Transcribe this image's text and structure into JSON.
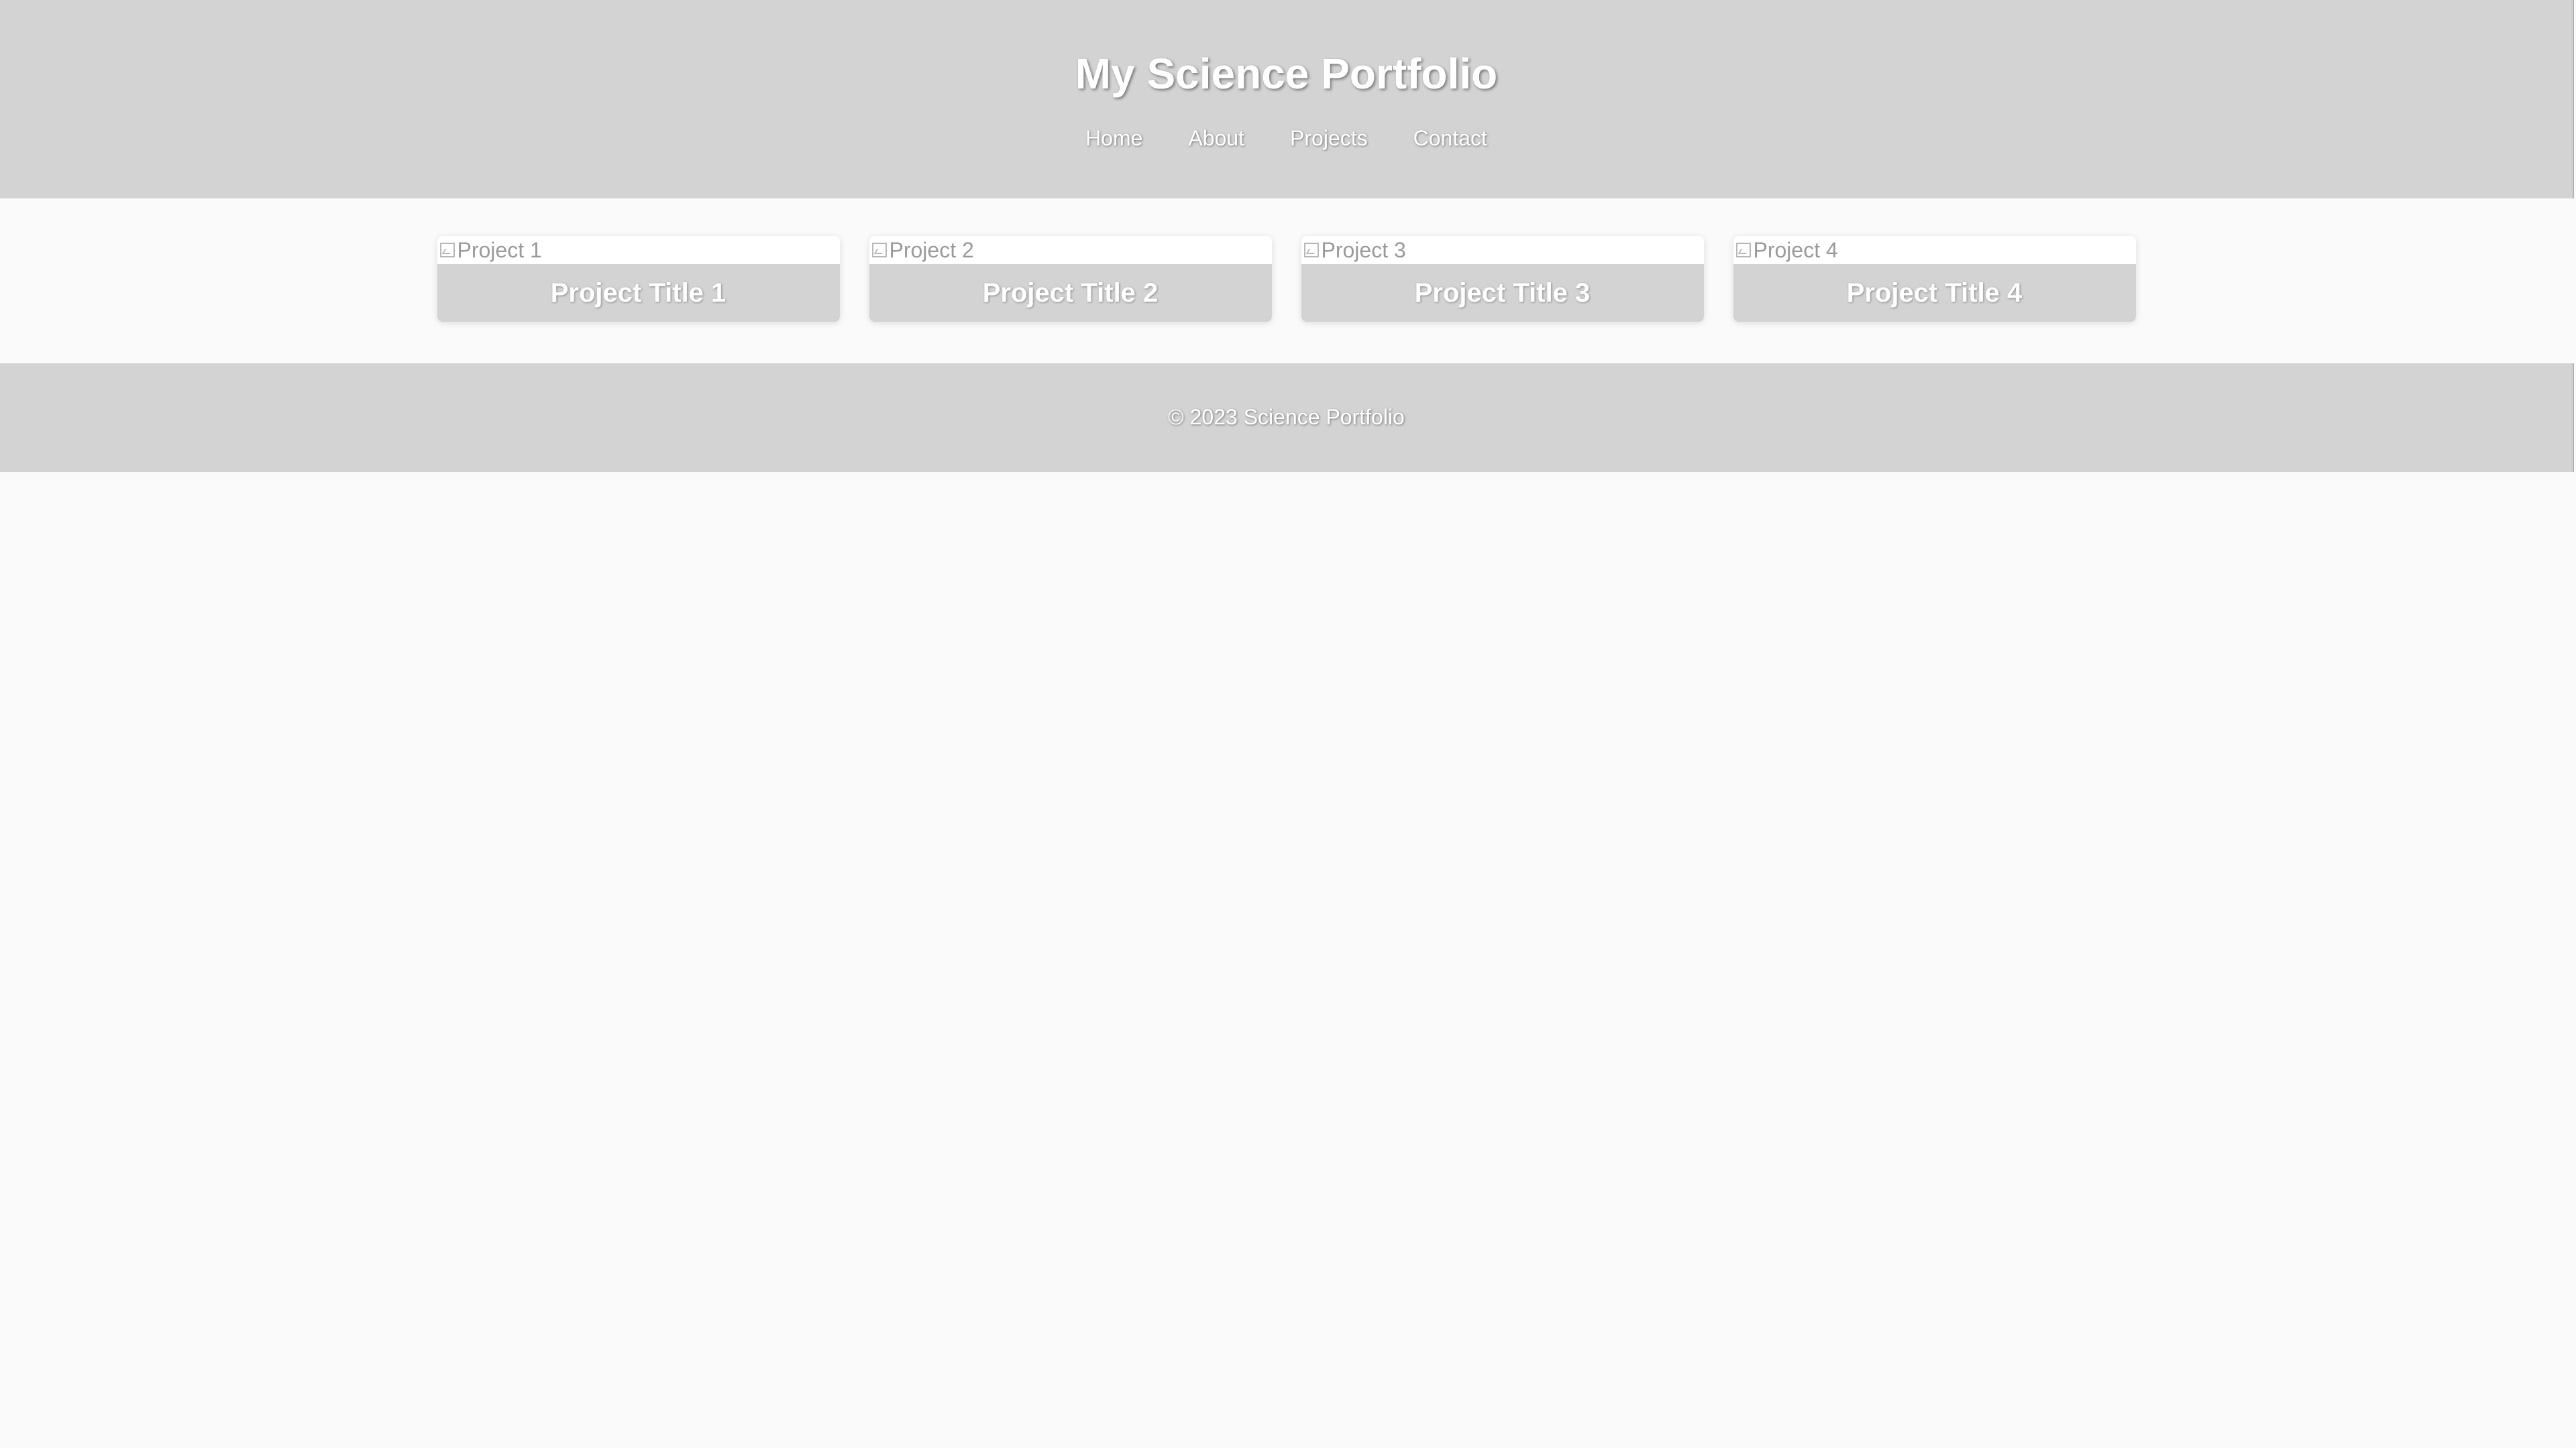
{
  "header": {
    "title": "My Science Portfolio",
    "nav": [
      "Home",
      "About",
      "Projects",
      "Contact"
    ]
  },
  "projects": [
    {
      "image_alt": "Project 1",
      "title": "Project Title 1"
    },
    {
      "image_alt": "Project 2",
      "title": "Project Title 2"
    },
    {
      "image_alt": "Project 3",
      "title": "Project Title 3"
    },
    {
      "image_alt": "Project 4",
      "title": "Project Title 4"
    }
  ],
  "footer": {
    "text": "© 2023 Science Portfolio"
  },
  "colors": {
    "header_bg": "#d3d3d3",
    "page_bg": "#fafafa",
    "text_light": "#ffffff",
    "alt_text": "#9a9a9a"
  },
  "icons": {
    "broken_image": "broken-image-icon"
  }
}
